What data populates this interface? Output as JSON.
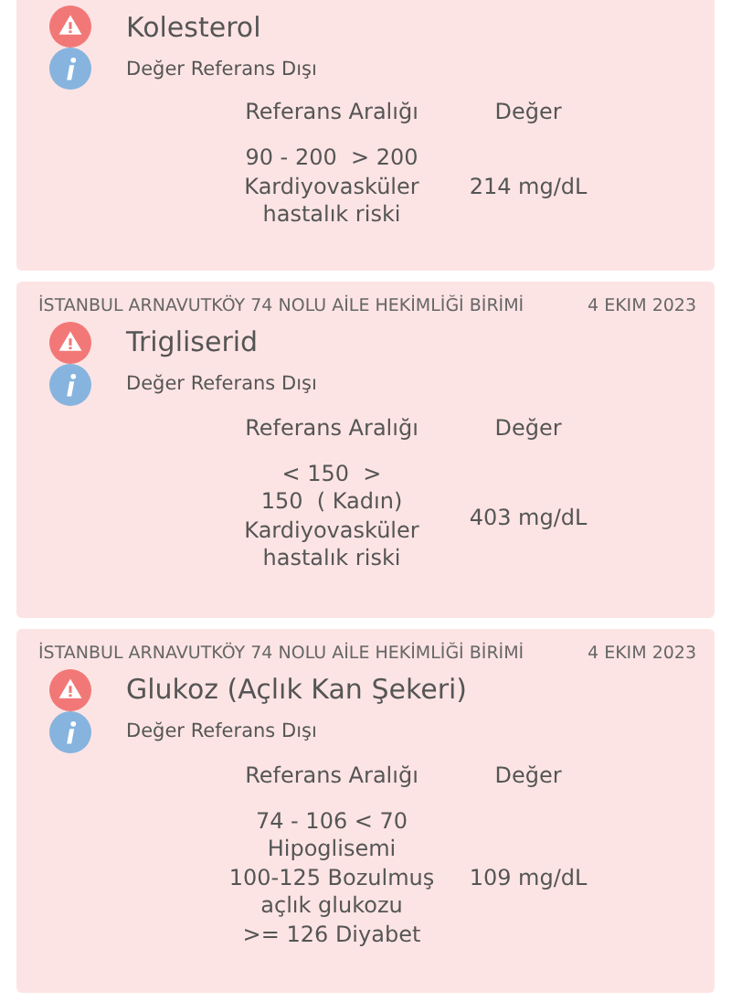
{
  "results": [
    {
      "name": "Kolesterol",
      "status": "Değer Referans Dışı",
      "range_heading": "Referans Aralığı",
      "value_heading": "Değer",
      "range": "90 - 200  > 200\nKardiyovasküler\nhastalık riski",
      "value": "214 mg/dL"
    },
    {
      "facility": "İSTANBUL ARNAVUTKÖY 74 NOLU AİLE HEKİMLİĞİ BİRİMİ",
      "date": "4 EKIM 2023",
      "name": "Trigliserid",
      "status": "Değer Referans Dışı",
      "range_heading": "Referans Aralığı",
      "value_heading": "Değer",
      "range": "< 150  >\n150  ( Kadın)\nKardiyovasküler\nhastalık riski",
      "value": "403 mg/dL"
    },
    {
      "facility": "İSTANBUL ARNAVUTKÖY 74 NOLU AİLE HEKİMLİĞİ BİRİMİ",
      "date": "4 EKIM 2023",
      "name": "Glukoz (Açlık Kan Şekeri)",
      "status": "Değer Referans Dışı",
      "range_heading": "Referans Aralığı",
      "value_heading": "Değer",
      "range": "74 - 106 < 70\nHipoglisemi\n100-125 Bozulmuş\naçlık glukozu\n>= 126 Diyabet",
      "value": "109 mg/dL"
    }
  ]
}
